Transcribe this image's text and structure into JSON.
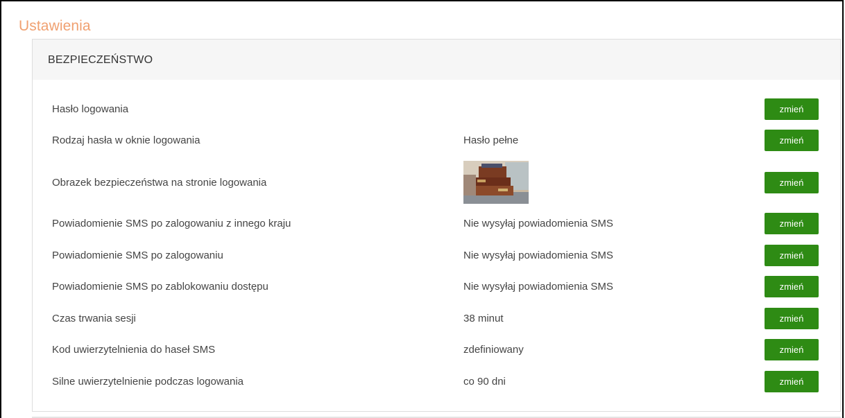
{
  "page": {
    "title": "Ustawienia"
  },
  "section": {
    "heading": "BEZPIECZEŃSTWO"
  },
  "settings": [
    {
      "label": "Hasło logowania",
      "value": "",
      "button": "zmień"
    },
    {
      "label": "Rodzaj hasła w oknie logowania",
      "value": "Hasło pełne",
      "button": "zmień"
    },
    {
      "label": "Obrazek bezpieczeństwa na stronie logowania",
      "value": "",
      "button": "zmień"
    },
    {
      "label": "Powiadomienie SMS po zalogowaniu z innego kraju",
      "value": "Nie wysyłaj powiadomienia SMS",
      "button": "zmień"
    },
    {
      "label": "Powiadomienie SMS po zalogowaniu",
      "value": "Nie wysyłaj powiadomienia SMS",
      "button": "zmień"
    },
    {
      "label": "Powiadomienie SMS po zablokowaniu dostępu",
      "value": "Nie wysyłaj powiadomienia SMS",
      "button": "zmień"
    },
    {
      "label": "Czas trwania sesji",
      "value": "38 minut",
      "button": "zmień"
    },
    {
      "label": "Kod uwierzytelnienia do haseł SMS",
      "value": "zdefiniowany",
      "button": "zmień"
    },
    {
      "label": "Silne uwierzytelnienie podczas logowania",
      "value": "co 90 dni",
      "button": "zmień"
    }
  ],
  "colors": {
    "title": "#f0a070",
    "button": "#2e8b14",
    "heading_bg": "#f6f6f6"
  }
}
